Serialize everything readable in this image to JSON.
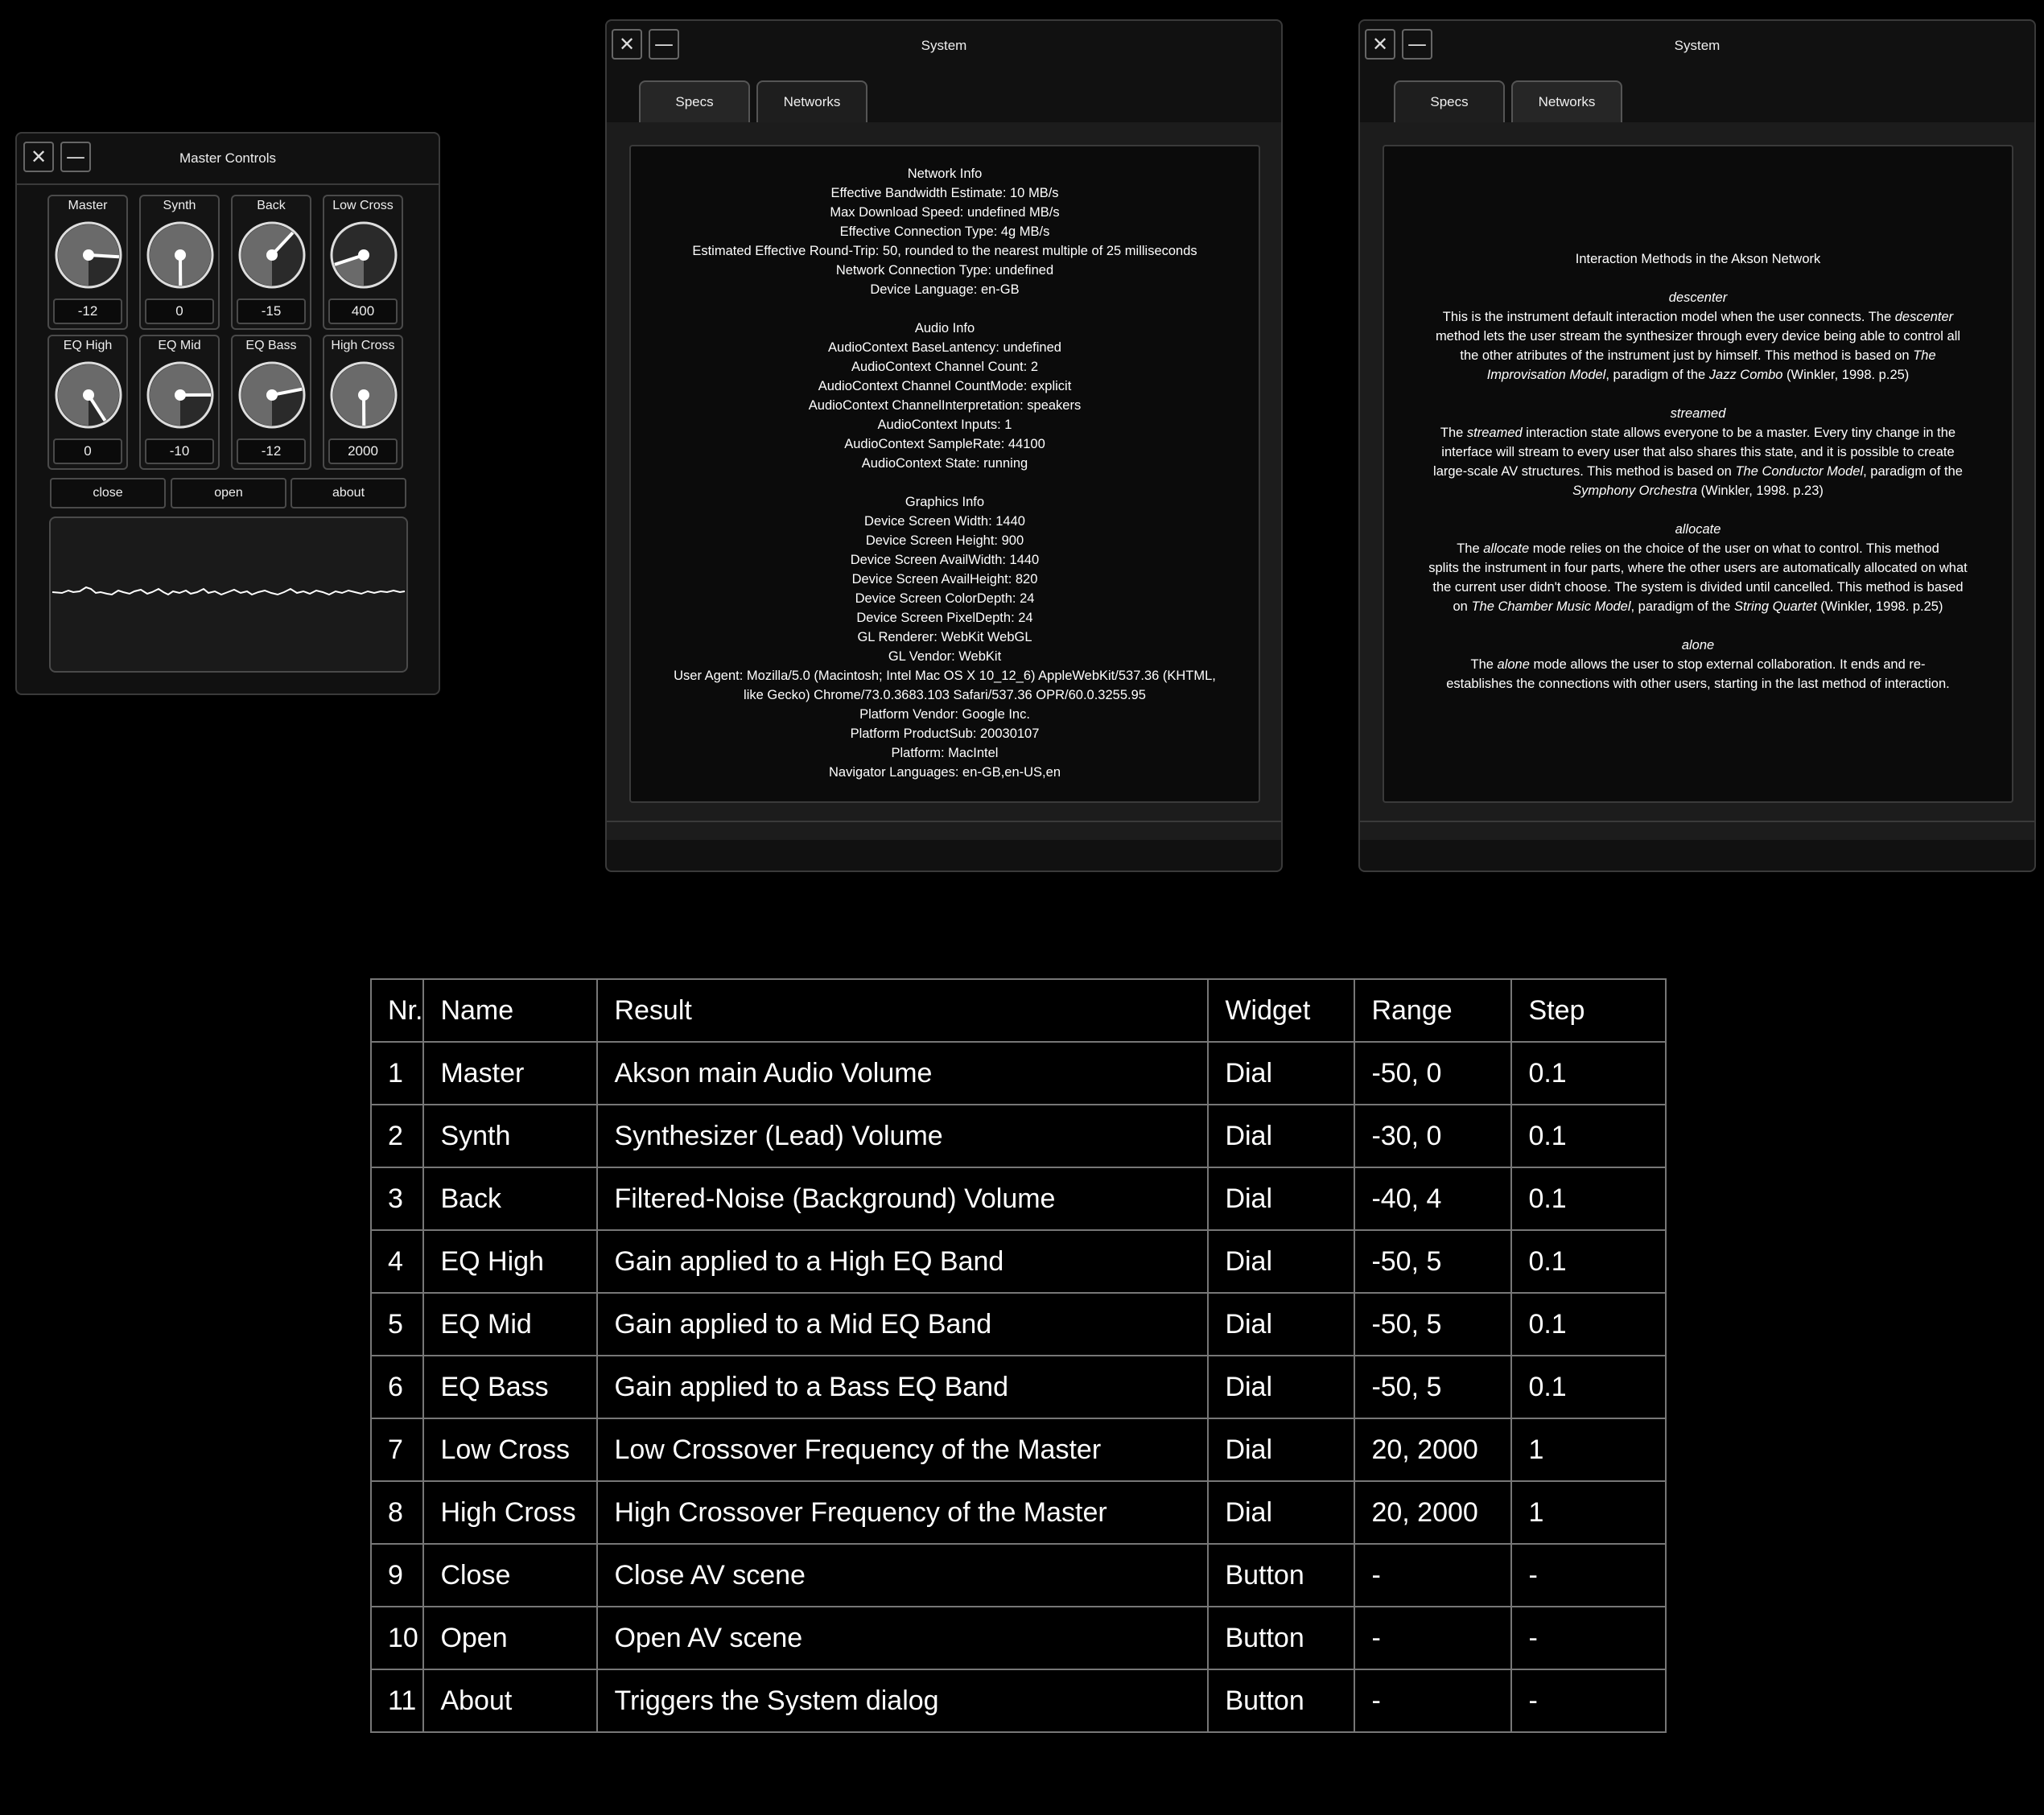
{
  "master_controls": {
    "title": "Master Controls",
    "knobs": [
      {
        "label": "Master",
        "value": "-12",
        "fill": 0.76
      },
      {
        "label": "Synth",
        "value": "0",
        "fill": 1.0
      },
      {
        "label": "Back",
        "value": "-15",
        "fill": 0.62
      },
      {
        "label": "Low Cross",
        "value": "400",
        "fill": 0.2
      },
      {
        "label": "EQ High",
        "value": "0",
        "fill": 0.91
      },
      {
        "label": "EQ Mid",
        "value": "-10",
        "fill": 0.75
      },
      {
        "label": "EQ Bass",
        "value": "-12",
        "fill": 0.72
      },
      {
        "label": "High Cross",
        "value": "2000",
        "fill": 1.0
      }
    ],
    "buttons": {
      "close": "close",
      "open": "open",
      "about": "about"
    }
  },
  "system_specs": {
    "title": "System",
    "tabs": [
      "Specs",
      "Networks"
    ],
    "lines": [
      "Network Info",
      "Effective Bandwidth Estimate: 10 MB/s",
      "Max Download Speed: undefined MB/s",
      "Effective Connection Type: 4g MB/s",
      "Estimated Effective Round-Trip: 50, rounded to the nearest multiple of 25 milliseconds",
      "Network Connection Type: undefined",
      "Device Language: en-GB",
      "",
      "Audio Info",
      "AudioContext BaseLantency: undefined",
      "AudioContext Channel Count: 2",
      "AudioContext Channel CountMode: explicit",
      "AudioContext ChannelInterpretation: speakers",
      "AudioContext Inputs: 1",
      "AudioContext SampleRate: 44100",
      "AudioContext State: running",
      "",
      "Graphics Info",
      "Device Screen Width: 1440",
      "Device Screen Height: 900",
      "Device Screen AvailWidth: 1440",
      "Device Screen AvailHeight: 820",
      "Device Screen ColorDepth: 24",
      "Device Screen PixelDepth: 24",
      "GL Renderer: WebKit WebGL",
      "GL Vendor: WebKit",
      "User Agent: Mozilla/5.0 (Macintosh; Intel Mac OS X 10_12_6) AppleWebKit/537.36 (KHTML,",
      "like Gecko) Chrome/73.0.3683.103 Safari/537.36 OPR/60.0.3255.95",
      "Platform Vendor: Google Inc.",
      "Platform ProductSub: 20030107",
      "Platform: MacIntel",
      "Navigator Languages: en-GB,en-US,en"
    ]
  },
  "system_networks": {
    "title": "System",
    "tabs": [
      "Specs",
      "Networks"
    ],
    "heading": "Interaction Methods in the Akson Network",
    "sections": [
      {
        "name": "descenter",
        "lines": [
          "This is the instrument default interaction model when the user connects. The <i>descenter</i>",
          "method lets the user stream the synthesizer through every device being able to control all",
          "the other atributes of the instrument just by himself. This method is based on <i>The</i>",
          "<i>Improvisation Model</i>, paradigm of the <i>Jazz Combo</i> (Winkler, 1998. p.25)"
        ]
      },
      {
        "name": "streamed",
        "lines": [
          "The <i>streamed</i> interaction state allows everyone to be a master. Every tiny change in the",
          "interface will stream to every user that also shares this state, and it is possible to create",
          "large-scale AV structures. This method is based on <i>The Conductor Model</i>, paradigm of the",
          "<i>Symphony Orchestra</i> (Winkler, 1998. p.23)"
        ]
      },
      {
        "name": "allocate",
        "lines": [
          "The <i>allocate</i> mode relies on the choice of the user on what to control. This method",
          "splits the instrument in four parts, where the other users are automatically allocated on what",
          "the current user didn't choose. The system is divided until cancelled. This method is based",
          "on <i>The Chamber Music Model</i>, paradigm of the <i>String Quartet</i> (Winkler, 1998. p.25)"
        ]
      },
      {
        "name": "alone",
        "lines": [
          "The <i>alone</i> mode allows the user to stop external collaboration. It ends and re-",
          "establishes the connections with other users, starting in the last method of interaction."
        ]
      }
    ]
  },
  "table": {
    "headers": [
      "Nr.",
      "Name",
      "Result",
      "Widget",
      "Range",
      "Step"
    ],
    "rows": [
      [
        "1",
        "Master",
        "Akson main Audio Volume",
        "Dial",
        "-50, 0",
        "0.1"
      ],
      [
        "2",
        "Synth",
        "Synthesizer (Lead) Volume",
        "Dial",
        "-30, 0",
        "0.1"
      ],
      [
        "3",
        "Back",
        "Filtered-Noise (Background) Volume",
        "Dial",
        "-40, 4",
        "0.1"
      ],
      [
        "4",
        "EQ High",
        "Gain applied to a High EQ Band",
        "Dial",
        "-50, 5",
        "0.1"
      ],
      [
        "5",
        "EQ Mid",
        "Gain applied to a Mid EQ Band",
        "Dial",
        "-50, 5",
        "0.1"
      ],
      [
        "6",
        "EQ Bass",
        "Gain applied to a Bass EQ Band",
        "Dial",
        "-50, 5",
        "0.1"
      ],
      [
        "7",
        "Low Cross",
        "Low Crossover Frequency of the Master",
        "Dial",
        "20, 2000",
        "1"
      ],
      [
        "8",
        "High Cross",
        "High Crossover Frequency of the Master",
        "Dial",
        "20, 2000",
        "1"
      ],
      [
        "9",
        "Close",
        "Close AV scene",
        "Button",
        "-",
        "-"
      ],
      [
        "10",
        "Open",
        "Open AV scene",
        "Button",
        "-",
        "-"
      ],
      [
        "11",
        "About",
        "Triggers the System dialog",
        "Button",
        "-",
        "-"
      ]
    ]
  }
}
